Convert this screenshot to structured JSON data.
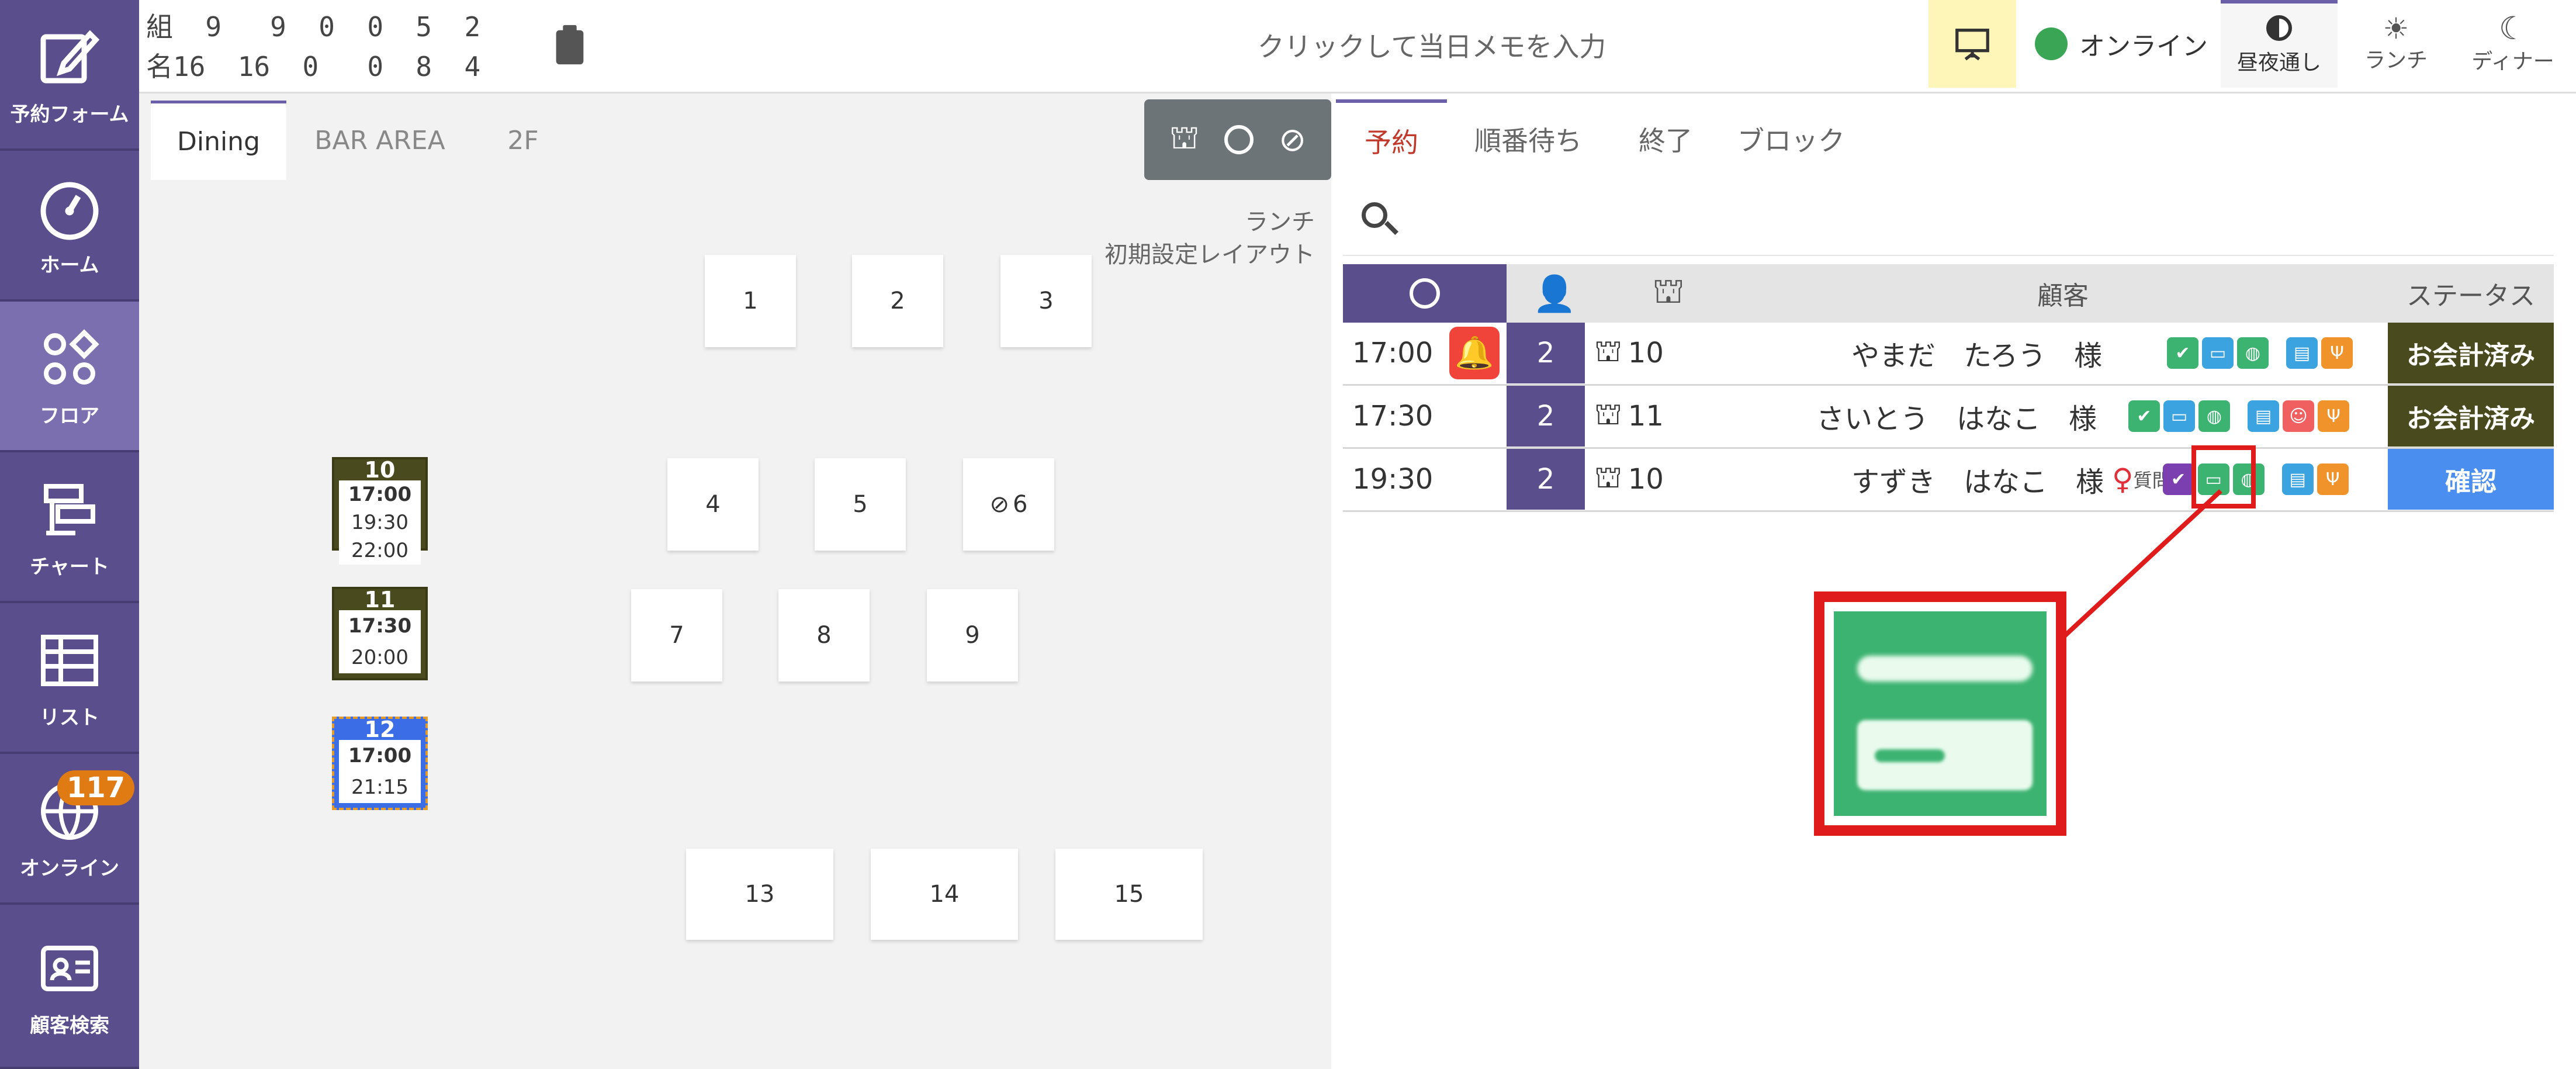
{
  "sidebar": {
    "items": [
      {
        "label": "予約フォーム",
        "icon": "edit-icon"
      },
      {
        "label": "ホーム",
        "icon": "gauge-icon"
      },
      {
        "label": "フロア",
        "icon": "shapes-icon"
      },
      {
        "label": "チャート",
        "icon": "chart-icon"
      },
      {
        "label": "リスト",
        "icon": "table-icon"
      },
      {
        "label": "オンライン",
        "icon": "globe-icon",
        "badge": "117"
      },
      {
        "label": "顧客検索",
        "icon": "id-card-icon"
      }
    ]
  },
  "topbar": {
    "counts_line1": "組  9   9  0  0  5  2",
    "counts_line2": "名16  16  0   0  8  4",
    "memo_placeholder": "クリックして当日メモを入力",
    "online_label": "オンライン",
    "segments": [
      {
        "label": "昼夜通し",
        "icon": "half-moon-icon"
      },
      {
        "label": "ランチ",
        "icon": "sun-icon"
      },
      {
        "label": "ディナー",
        "icon": "moon-icon"
      }
    ]
  },
  "floor": {
    "tabs": [
      "Dining",
      "BAR AREA",
      "2F"
    ],
    "layout_line1": "ランチ",
    "layout_line2": "初期設定レイアウト",
    "tables": [
      "1",
      "2",
      "3",
      "4",
      "5",
      "6",
      "7",
      "8",
      "9",
      "13",
      "14",
      "15"
    ],
    "occupied": [
      {
        "num": "10",
        "times": [
          "17:00",
          "19:30",
          "22:00"
        ]
      },
      {
        "num": "11",
        "times": [
          "17:30",
          "20:00"
        ]
      },
      {
        "num": "12",
        "times": [
          "17:00",
          "21:15"
        ]
      }
    ]
  },
  "reservations": {
    "tabs": [
      "予約",
      "順番待ち",
      "終了",
      "ブロック"
    ],
    "header": {
      "customer": "顧客",
      "status": "ステータス"
    },
    "rows": [
      {
        "time": "17:00",
        "people": "2",
        "table": "10",
        "name": "やまだ　たろう　様",
        "status": "お会計済み",
        "status_color": "#4a4a1f"
      },
      {
        "time": "17:30",
        "people": "2",
        "table": "11",
        "name": "さいとう　はなこ　様",
        "status": "お会計済み",
        "status_color": "#4a4a1f"
      },
      {
        "time": "19:30",
        "people": "2",
        "table": "10",
        "name": "すずき　はなこ　様",
        "status": "確認",
        "status_color": "#4a8ef0",
        "note": "質問"
      }
    ]
  },
  "colors": {
    "accent": "#5a4e8c",
    "card": "#3cb371",
    "highlight": "#e01b1b"
  }
}
